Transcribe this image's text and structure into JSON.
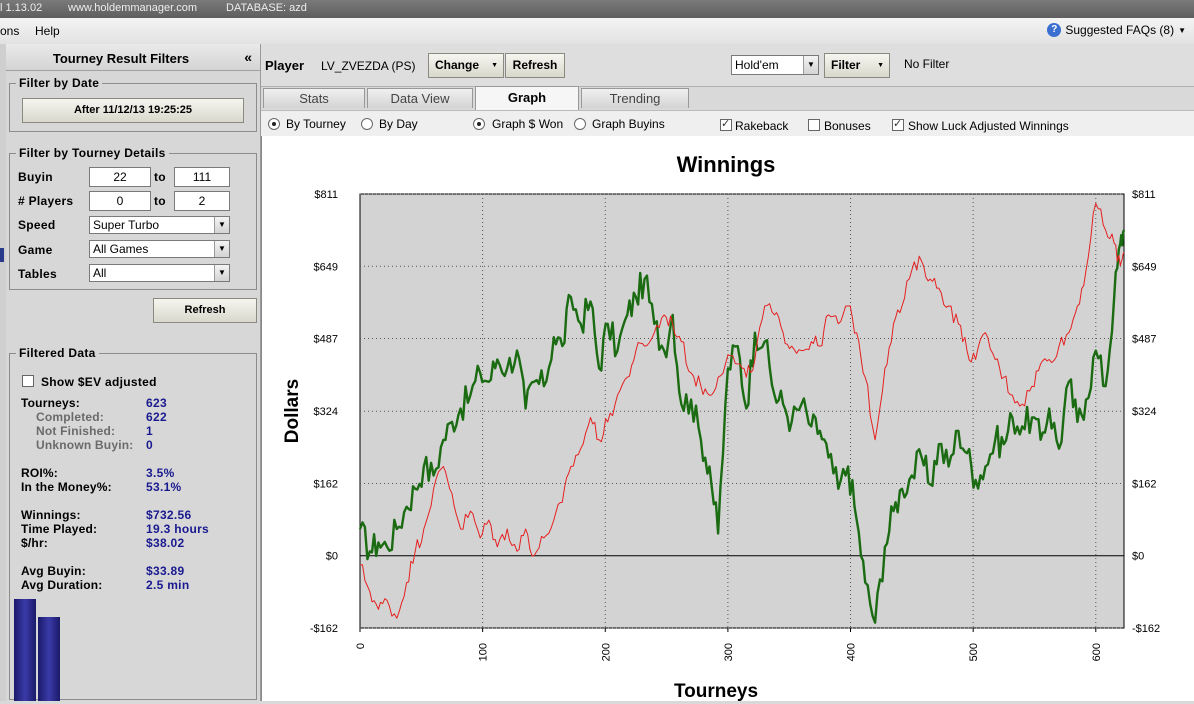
{
  "window": {
    "version": "l 1.13.02",
    "url": "www.holdemmanager.com",
    "database": "DATABASE: azd"
  },
  "menu": {
    "items": [
      "ons",
      "Help"
    ],
    "faq_label": "Suggested FAQs (8)"
  },
  "left_panel": {
    "title": "Tourney Result Filters",
    "collapse_glyph": "«",
    "filter_by_date": {
      "legend": "Filter by Date",
      "button": "After 11/12/13 19:25:25"
    },
    "filter_by_details": {
      "legend": "Filter by Tourney Details",
      "buyin_label": "Buyin",
      "buyin_from": "22",
      "buyin_to": "111",
      "players_label": "# Players",
      "players_from": "0",
      "players_to": "2",
      "to_label": "to",
      "speed_label": "Speed",
      "speed_value": "Super Turbo",
      "game_label": "Game",
      "game_value": "All Games",
      "tables_label": "Tables",
      "tables_value": "All"
    },
    "refresh_button": "Refresh",
    "filtered_data": {
      "legend": "Filtered Data",
      "show_ev_label": "Show $EV adjusted",
      "show_ev_checked": false,
      "stats": [
        {
          "label": "Tourneys:",
          "value": "623",
          "sub": false
        },
        {
          "label": "Completed:",
          "value": "622",
          "sub": true
        },
        {
          "label": "Not Finished:",
          "value": "1",
          "sub": true
        },
        {
          "label": "Unknown Buyin:",
          "value": "0",
          "sub": true
        },
        {
          "label": "ROI%:",
          "value": "3.5%",
          "sub": false
        },
        {
          "label": "In the Money%:",
          "value": "53.1%",
          "sub": false
        },
        {
          "label": "Winnings:",
          "value": "$732.56",
          "sub": false
        },
        {
          "label": "Time Played:",
          "value": "19.3 hours",
          "sub": false
        },
        {
          "label": "$/hr:",
          "value": "$38.02",
          "sub": false
        },
        {
          "label": "Avg Buyin:",
          "value": "$33.89",
          "sub": false
        },
        {
          "label": "Avg Duration:",
          "value": "2.5 min",
          "sub": false
        }
      ]
    }
  },
  "player_bar": {
    "player_label": "Player",
    "player_name": "LV_ZVEZDA (PS)",
    "change_button": "Change",
    "refresh_button": "Refresh",
    "game_select": "Hold'em",
    "filter_button": "Filter",
    "filter_status": "No Filter"
  },
  "tabs": [
    {
      "label": "Stats",
      "active": false
    },
    {
      "label": "Data View",
      "active": false
    },
    {
      "label": "Graph",
      "active": true
    },
    {
      "label": "Trending",
      "active": false
    }
  ],
  "options": {
    "by_tourney": "By Tourney",
    "by_day": "By Day",
    "graph_won": "Graph $ Won",
    "graph_buyins": "Graph Buyins",
    "rakeback": "Rakeback",
    "bonuses": "Bonuses",
    "show_luck": "Show Luck Adjusted Winnings",
    "by_tourney_selected": true,
    "graph_won_selected": true,
    "rakeback_checked": true,
    "bonuses_checked": false,
    "show_luck_checked": true
  },
  "chart_data": {
    "type": "line",
    "title": "Winnings",
    "xlabel": "Tourneys",
    "ylabel": "Dollars",
    "xlim": [
      0,
      623
    ],
    "ylim": [
      -162,
      811
    ],
    "x_ticks": [
      0,
      100,
      200,
      300,
      400,
      500,
      600
    ],
    "y_ticks": [
      -162,
      0,
      162,
      324,
      487,
      649,
      811
    ],
    "y_tick_labels": [
      "-$162",
      "$0",
      "$162",
      "$324",
      "$487",
      "$649",
      "$811"
    ],
    "grid": true,
    "series": [
      {
        "color": "#1a6b12",
        "x": [
          0,
          8,
          15,
          22,
          30,
          38,
          45,
          52,
          60,
          68,
          75,
          82,
          90,
          98,
          105,
          112,
          120,
          128,
          135,
          142,
          150,
          158,
          165,
          172,
          180,
          188,
          195,
          202,
          210,
          218,
          225,
          232,
          240,
          248,
          255,
          262,
          270,
          278,
          285,
          292,
          300,
          308,
          315,
          322,
          330,
          338,
          345,
          352,
          360,
          368,
          375,
          382,
          390,
          398,
          405,
          412,
          420,
          428,
          435,
          442,
          450,
          458,
          465,
          472,
          480,
          488,
          495,
          502,
          510,
          518,
          525,
          532,
          540,
          548,
          555,
          562,
          570,
          578,
          585,
          592,
          600,
          608,
          615,
          620,
          623
        ],
        "y": [
          60,
          10,
          30,
          20,
          60,
          110,
          150,
          200,
          180,
          260,
          300,
          330,
          360,
          410,
          390,
          440,
          420,
          460,
          330,
          390,
          380,
          490,
          470,
          580,
          520,
          570,
          420,
          520,
          460,
          540,
          580,
          620,
          520,
          460,
          540,
          340,
          350,
          260,
          200,
          50,
          420,
          470,
          330,
          500,
          480,
          360,
          340,
          300,
          340,
          290,
          280,
          220,
          150,
          200,
          80,
          -60,
          -150,
          20,
          100,
          150,
          180,
          220,
          160,
          250,
          200,
          280,
          230,
          170,
          200,
          260,
          250,
          310,
          290,
          310,
          260,
          330,
          240,
          390,
          300,
          350,
          460,
          380,
          580,
          700,
          730
        ]
      },
      {
        "color": "#e62020",
        "x": [
          0,
          8,
          15,
          22,
          30,
          38,
          45,
          52,
          60,
          68,
          75,
          82,
          90,
          98,
          105,
          112,
          120,
          128,
          135,
          142,
          150,
          158,
          165,
          172,
          180,
          188,
          195,
          202,
          210,
          218,
          225,
          232,
          240,
          248,
          255,
          262,
          270,
          278,
          285,
          292,
          300,
          308,
          315,
          322,
          330,
          338,
          345,
          352,
          360,
          368,
          375,
          382,
          390,
          398,
          405,
          412,
          420,
          428,
          435,
          442,
          450,
          458,
          465,
          472,
          480,
          488,
          495,
          502,
          510,
          518,
          525,
          532,
          540,
          548,
          555,
          562,
          570,
          578,
          585,
          592,
          600,
          608,
          615,
          620,
          623
        ],
        "y": [
          -20,
          -80,
          -120,
          -100,
          -140,
          -60,
          10,
          60,
          150,
          200,
          140,
          60,
          100,
          40,
          80,
          20,
          60,
          10,
          60,
          0,
          40,
          80,
          120,
          200,
          240,
          310,
          260,
          300,
          360,
          400,
          460,
          470,
          500,
          540,
          520,
          480,
          410,
          380,
          360,
          400,
          450,
          430,
          400,
          440,
          560,
          540,
          500,
          470,
          460,
          480,
          470,
          540,
          520,
          560,
          500,
          400,
          260,
          420,
          520,
          560,
          640,
          660,
          620,
          600,
          560,
          520,
          460,
          440,
          500,
          440,
          400,
          360,
          340,
          380,
          430,
          440,
          470,
          500,
          560,
          640,
          790,
          730,
          700,
          650,
          680
        ]
      }
    ]
  },
  "mini_bars": [
    0.93,
    0.76
  ]
}
